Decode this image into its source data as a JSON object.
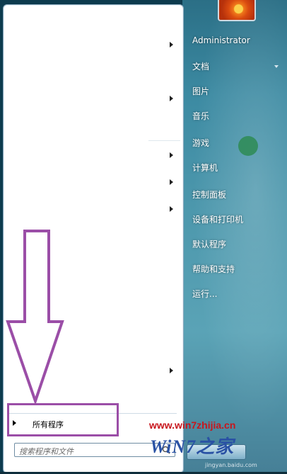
{
  "left_pane": {
    "all_programs_label": "所有程序",
    "search_placeholder": "搜索程序和文件"
  },
  "right_pane": {
    "items": [
      {
        "label": "Administrator"
      },
      {
        "label": "文档"
      },
      {
        "label": "图片"
      },
      {
        "label": "音乐"
      },
      {
        "label": "游戏"
      },
      {
        "label": "计算机"
      },
      {
        "label": "控制面板"
      },
      {
        "label": "设备和打印机"
      },
      {
        "label": "默认程序"
      },
      {
        "label": "帮助和支持"
      },
      {
        "label": "运行..."
      }
    ]
  },
  "watermark": {
    "url": "www.win7zhijia.cn",
    "logo": "WiN7之家",
    "domain": "jingyan.baidu.com"
  },
  "annotation": {
    "arrow_color": "#9b4ea7",
    "highlight_color": "#9b4ea7"
  },
  "icons": [
    "arrow-right-icon",
    "search-icon",
    "chevron-down-icon",
    "user-picture",
    "annotation-arrow"
  ]
}
